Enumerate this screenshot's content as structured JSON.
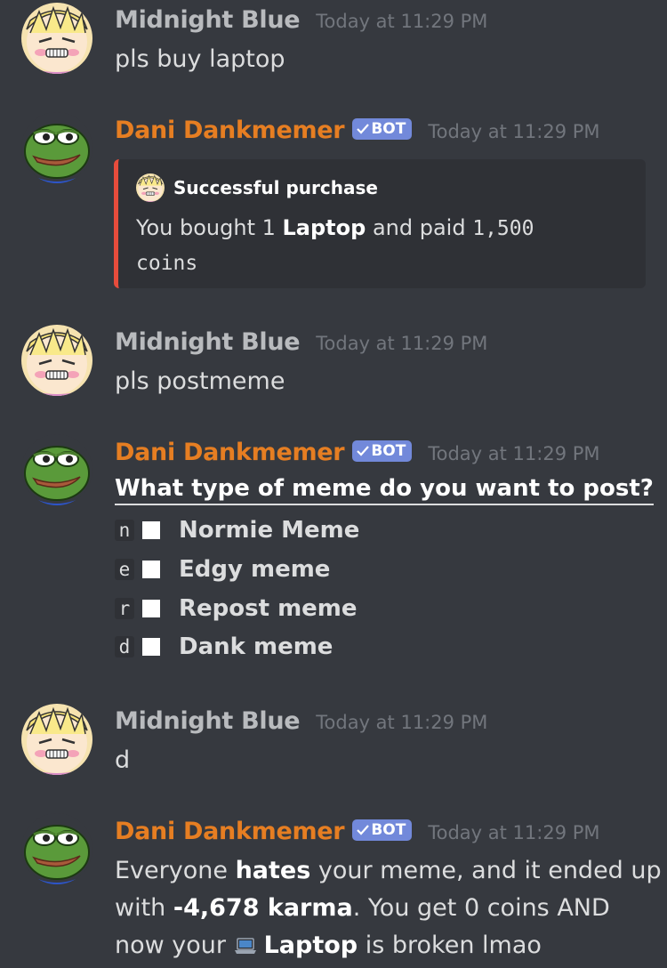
{
  "messages": [
    {
      "author": "Midnight Blue",
      "timestamp": "Today at 11:29 PM",
      "text": "pls buy laptop"
    },
    {
      "author": "Dani Dankmemer",
      "bot_tag": "BOT",
      "timestamp": "Today at 11:29 PM",
      "embed": {
        "author": "Successful purchase",
        "desc_prefix": "You bought 1 ",
        "item": "Laptop",
        "desc_mid": " and paid ",
        "amount": "1,500",
        "desc_suffix": "coins",
        "accent_color": "#e74c3c"
      }
    },
    {
      "author": "Midnight Blue",
      "timestamp": "Today at 11:29 PM",
      "text": "pls postmeme"
    },
    {
      "author": "Dani Dankmemer",
      "bot_tag": "BOT",
      "timestamp": "Today at 11:29 PM",
      "question": "What type of meme do you want to post?",
      "options": [
        {
          "key": "n",
          "label": "Normie Meme"
        },
        {
          "key": "e",
          "label": "Edgy meme"
        },
        {
          "key": "r",
          "label": "Repost meme"
        },
        {
          "key": "d",
          "label": "Dank meme"
        }
      ]
    },
    {
      "author": "Midnight Blue",
      "timestamp": "Today at 11:29 PM",
      "text": "d"
    },
    {
      "author": "Dani Dankmemer",
      "bot_tag": "BOT",
      "timestamp": "Today at 11:29 PM",
      "result": {
        "p1": "Everyone ",
        "b1": "hates",
        "p2": " your meme, and it ended up",
        "p3": "with ",
        "b2": "-4,678 karma",
        "p4": ". You get 0 coins AND",
        "p5": "now your ",
        "b3": "Laptop",
        "p6": " is broken lmao",
        "icon": "laptop-icon"
      }
    }
  ],
  "colors": {
    "background": "#36393f",
    "bot_name": "#e67e22",
    "user_name": "#b9bbbe",
    "bot_tag": "#7289da",
    "embed_bg": "#2f3136"
  }
}
